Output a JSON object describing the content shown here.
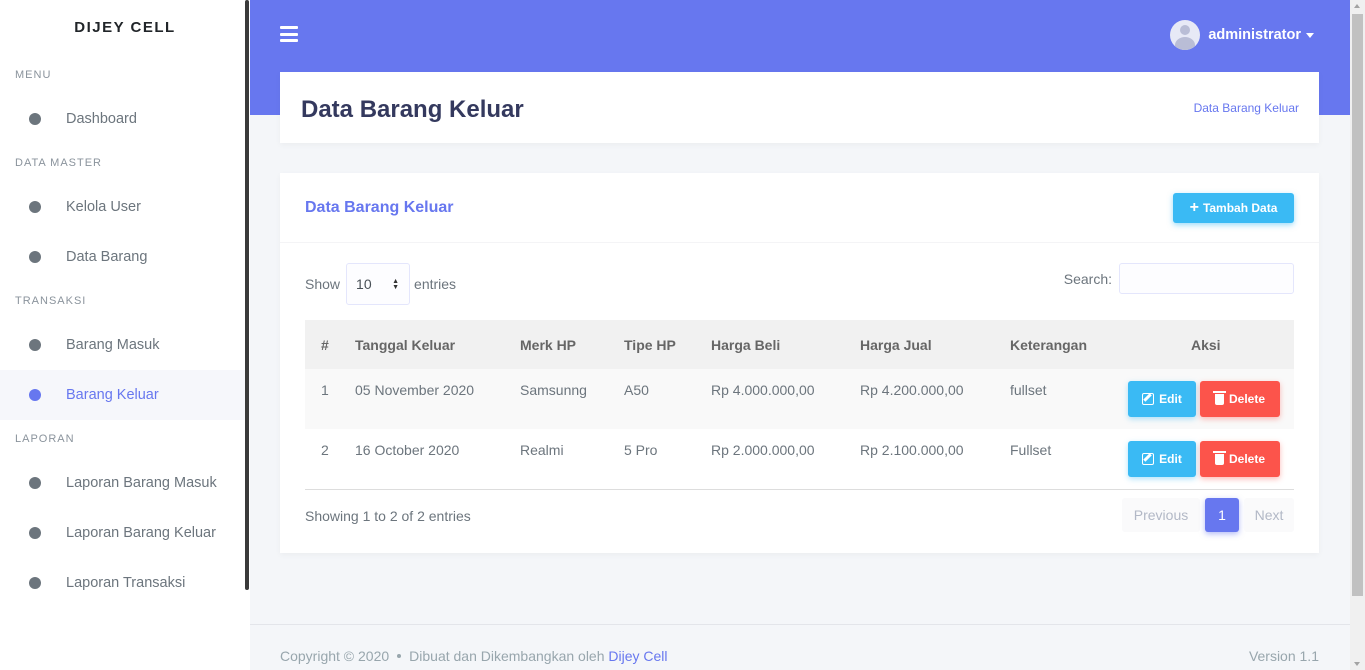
{
  "sidebar": {
    "brand": "DIJEY CELL",
    "sections": [
      {
        "header": "MENU",
        "items": [
          {
            "label": "Dashboard"
          }
        ]
      },
      {
        "header": "DATA MASTER",
        "items": [
          {
            "label": "Kelola User"
          },
          {
            "label": "Data Barang"
          }
        ]
      },
      {
        "header": "TRANSAKSI",
        "items": [
          {
            "label": "Barang Masuk"
          },
          {
            "label": "Barang Keluar",
            "active": true
          }
        ]
      },
      {
        "header": "LAPORAN",
        "items": [
          {
            "label": "Laporan Barang Masuk"
          },
          {
            "label": "Laporan Barang Keluar"
          },
          {
            "label": "Laporan Transaksi"
          }
        ]
      }
    ]
  },
  "topbar": {
    "user_name": "administrator"
  },
  "page_header": {
    "title": "Data Barang Keluar",
    "breadcrumb": "Data Barang Keluar"
  },
  "card": {
    "title": "Data Barang Keluar",
    "add_button": "Tambah Data",
    "show_label": "Show",
    "show_value": "10",
    "entries_label": "entries",
    "search_label": "Search:",
    "search_value": ""
  },
  "table": {
    "headers": [
      "#",
      "Tanggal Keluar",
      "Merk HP",
      "Tipe HP",
      "Harga Beli",
      "Harga Jual",
      "Keterangan",
      "Aksi"
    ],
    "rows": [
      {
        "no": "1",
        "tanggal": "05 November 2020",
        "merk": "Samsunng",
        "tipe": "A50",
        "beli": "Rp 4.000.000,00",
        "jual": "Rp 4.200.000,00",
        "ket": "fullset"
      },
      {
        "no": "2",
        "tanggal": "16 October 2020",
        "merk": "Realmi",
        "tipe": "5 Pro",
        "beli": "Rp 2.000.000,00",
        "jual": "Rp 2.100.000,00",
        "ket": "Fullset"
      }
    ],
    "edit_label": "Edit",
    "delete_label": "Delete"
  },
  "pagination": {
    "info": "Showing 1 to 2 of 2 entries",
    "previous": "Previous",
    "current": "1",
    "next": "Next"
  },
  "footer": {
    "copyright": "Copyright © 2020",
    "credit": "Dibuat dan Dikembangkan oleh",
    "author": "Dijey Cell",
    "version": "Version 1.1"
  },
  "colors": {
    "primary": "#6777ef",
    "info": "#3abaf4",
    "danger": "#fc544b"
  }
}
